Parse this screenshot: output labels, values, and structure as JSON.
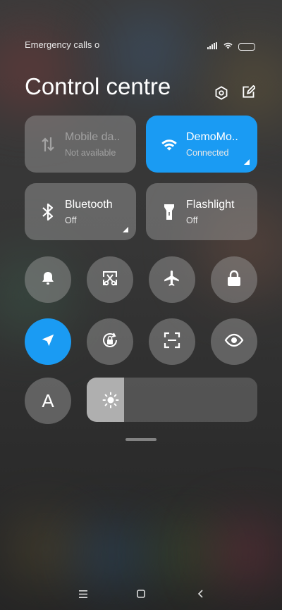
{
  "status_bar": {
    "carrier_text": "Emergency calls o",
    "icons": [
      "signal-icon",
      "wifi-icon",
      "battery-icon"
    ]
  },
  "header": {
    "title": "Control centre",
    "icons": [
      "settings-icon",
      "edit-icon"
    ]
  },
  "tiles": [
    {
      "label": "Mobile da..",
      "status": "Not available",
      "icon": "mobile-data-icon",
      "state": "disabled"
    },
    {
      "label": "DemoMo..",
      "status": "Connected",
      "icon": "wifi-icon",
      "state": "active"
    },
    {
      "label": "Bluetooth",
      "status": "Off",
      "icon": "bluetooth-icon",
      "state": "off"
    },
    {
      "label": "Flashlight",
      "status": "Off",
      "icon": "flashlight-icon",
      "state": "off"
    }
  ],
  "toggles": [
    {
      "icon": "bell-icon",
      "state": "off"
    },
    {
      "icon": "screenshot-icon",
      "state": "off"
    },
    {
      "icon": "airplane-icon",
      "state": "off"
    },
    {
      "icon": "lock-icon",
      "state": "off"
    },
    {
      "icon": "location-icon",
      "state": "on"
    },
    {
      "icon": "rotation-lock-icon",
      "state": "off"
    },
    {
      "icon": "scanner-icon",
      "state": "off"
    },
    {
      "icon": "reading-mode-icon",
      "state": "off"
    }
  ],
  "auto_brightness": {
    "label": "A"
  },
  "brightness": {
    "level": 0.22,
    "icon": "sun-icon"
  },
  "navigation": [
    "menu-icon",
    "home-icon",
    "back-icon"
  ],
  "colors": {
    "accent": "#1a9bf3",
    "tile_bg": "rgba(160,160,160,0.45)"
  }
}
